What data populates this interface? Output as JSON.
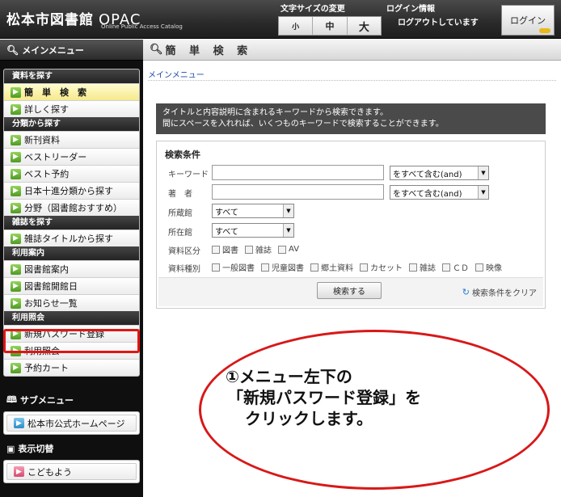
{
  "header": {
    "logo": "松本市図書館",
    "opac": "OPAC",
    "subtitle": "Online Public Access Catalog",
    "font_size_title": "文字サイズの変更",
    "font_sizes": [
      "小",
      "中",
      "大"
    ],
    "login_info_title": "ログイン情報",
    "login_status": "ログアウトしています",
    "login_button": "ログイン"
  },
  "sidebar": {
    "main_menu_title": "メインメニュー",
    "groups": [
      {
        "label": "資料を探す",
        "items": [
          "簡　単　検　索",
          "詳しく探す"
        ]
      },
      {
        "label": "分類から探す",
        "items": [
          "新刊資料",
          "ベストリーダー",
          "ベスト予約",
          "日本十進分類から探す",
          "分野（図書館おすすめ）"
        ]
      },
      {
        "label": "雑誌を探す",
        "items": [
          "雑誌タイトルから探す"
        ]
      },
      {
        "label": "利用案内",
        "items": [
          "図書館案内",
          "図書館開館日",
          "お知らせ一覧"
        ]
      },
      {
        "label": "利用照会",
        "items": [
          "新規パスワード登録",
          "利用照会",
          "予約カート"
        ]
      }
    ],
    "sub_menu_title": "サブメニュー",
    "sub_menu_item": "松本市公式ホームページ",
    "display_switch_title": "表示切替",
    "display_switch_item": "こどもよう"
  },
  "main": {
    "page_title": "簡 単 検 索",
    "breadcrumb": "メインメニュー",
    "info_lines": [
      "タイトルと内容説明に含まれるキーワードから検索できます。",
      "間にスペースを入れれば、いくつものキーワードで検索することができます。"
    ],
    "form": {
      "title": "検索条件",
      "keyword_label": "キーワード",
      "keyword_value": "",
      "keyword_mode": "をすべて含む(and)",
      "author_label": "著　者",
      "author_value": "",
      "author_mode": "をすべて含む(and)",
      "holding_label": "所蔵館",
      "holding_value": "すべて",
      "location_label": "所在館",
      "location_value": "すべて",
      "category_label": "資料区分",
      "categories": [
        "図書",
        "雑誌",
        "AV"
      ],
      "type_label": "資料種別",
      "types": [
        "一般図書",
        "児童図書",
        "郷土資料",
        "カセット",
        "雑誌",
        "ＣＤ",
        "映像"
      ],
      "search_button": "検索する",
      "clear_link": "検索条件をクリア"
    }
  },
  "callout": {
    "lines": [
      "①メニュー左下の",
      "「新規パスワード登録」を",
      "クリックします。"
    ],
    "border_color": "#d81818"
  }
}
